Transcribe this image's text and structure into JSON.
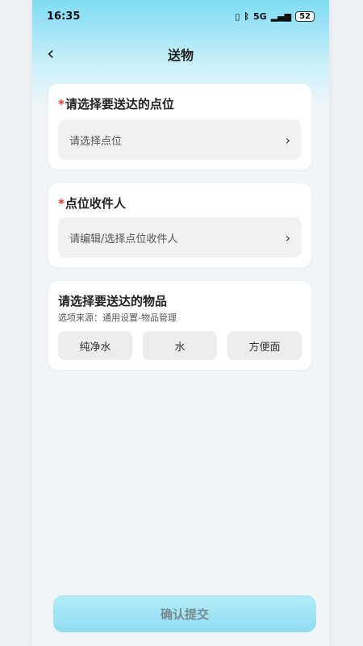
{
  "status_bar": {
    "time": "16:35",
    "battery": "52",
    "network": "5G"
  },
  "header": {
    "title": "送物",
    "back_icon": "chevron-left-icon"
  },
  "point_section": {
    "required_mark": "*",
    "label": "请选择要送达的点位",
    "placeholder": "请选择点位"
  },
  "recipient_section": {
    "required_mark": "*",
    "label": "点位收件人",
    "placeholder": "请编辑/选择点位收件人"
  },
  "items_section": {
    "label": "请选择要送达的物品",
    "source_note": "选项来源：通用设置-物品管理",
    "options": [
      "纯净水",
      "水",
      "方便面"
    ]
  },
  "submit_button": {
    "label": "确认提交"
  },
  "colors": {
    "accent": "#8fdcf1",
    "required": "#e53935"
  }
}
